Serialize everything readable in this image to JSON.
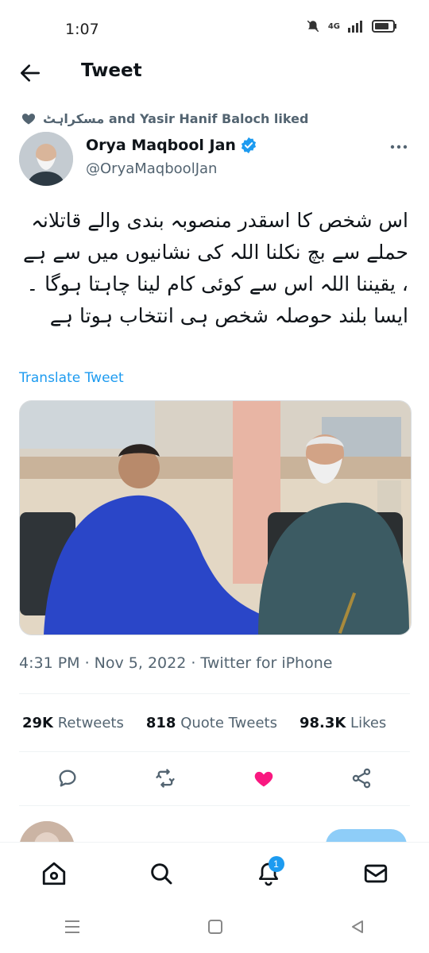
{
  "status_bar": {
    "time": "1:07",
    "network": "4G"
  },
  "header": {
    "title": "Tweet"
  },
  "social_context": {
    "text": "مسکراہٹ and Yasir Hanif Baloch liked"
  },
  "author": {
    "name": "Orya Maqbool Jan",
    "handle": "@OryaMaqboolJan"
  },
  "tweet": {
    "text": "اس شخص کا اسقدر منصوبہ بندی والے قاتلانہ حملے سے بچ نکلنا اللہ کی نشانیوں میں سے ہے ، یقیننا اللہ اس سے کوئی کام لینا چاہتا ہوگا ۔ ایسا بلند حوصلہ شخص ہی انتخاب ہوتا ہے",
    "translate_label": "Translate Tweet",
    "meta": "4:31 PM · Nov 5, 2022 · Twitter for iPhone"
  },
  "stats": {
    "retweets_count": "29K",
    "retweets_label": "Retweets",
    "quotes_count": "818",
    "quotes_label": "Quote Tweets",
    "likes_count": "98.3K",
    "likes_label": "Likes"
  },
  "colors": {
    "accent": "#1d9bf0",
    "like": "#f91880",
    "muted": "#536471"
  },
  "tabbar": {
    "notification_count": "1"
  }
}
